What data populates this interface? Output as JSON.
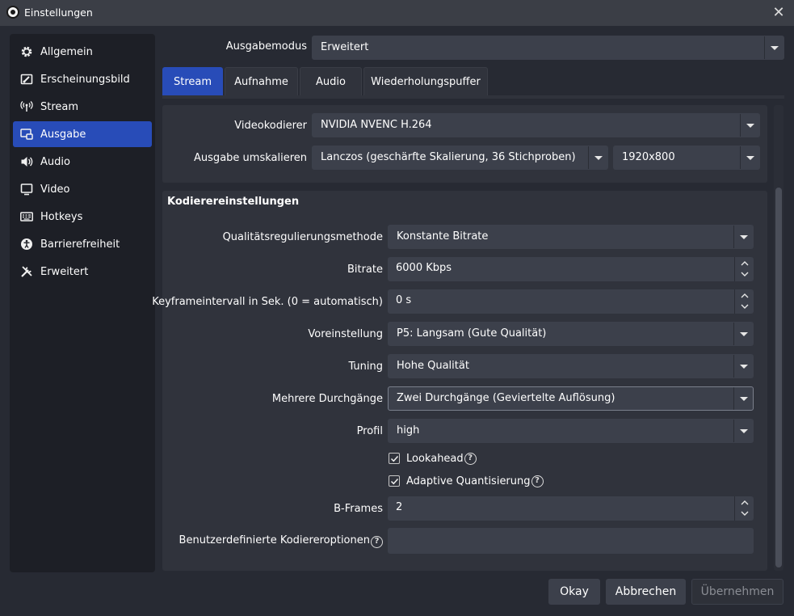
{
  "window": {
    "title": "Einstellungen",
    "close_glyph": "✕"
  },
  "sidebar": {
    "items": [
      {
        "label": "Allgemein",
        "icon": "gear-icon"
      },
      {
        "label": "Erscheinungsbild",
        "icon": "appearance-icon"
      },
      {
        "label": "Stream",
        "icon": "antenna-icon"
      },
      {
        "label": "Ausgabe",
        "icon": "output-icon",
        "active": true
      },
      {
        "label": "Audio",
        "icon": "speaker-icon"
      },
      {
        "label": "Video",
        "icon": "monitor-icon"
      },
      {
        "label": "Hotkeys",
        "icon": "keyboard-icon"
      },
      {
        "label": "Barrierefreiheit",
        "icon": "accessibility-icon"
      },
      {
        "label": "Erweitert",
        "icon": "tools-icon"
      }
    ]
  },
  "output_mode": {
    "label": "Ausgabemodus",
    "value": "Erweitert"
  },
  "tabs": [
    {
      "label": "Stream",
      "active": true
    },
    {
      "label": "Aufnahme"
    },
    {
      "label": "Audio"
    },
    {
      "label": "Wiederholungspuffer"
    }
  ],
  "encoder": {
    "label": "Videokodierer",
    "value": "NVIDIA NVENC H.264"
  },
  "rescale": {
    "label": "Ausgabe umskalieren",
    "filter": "Lanczos (geschärfte Skalierung, 36 Stichproben)",
    "resolution": "1920x800"
  },
  "encoder_settings": {
    "title": "Kodierereinstellungen",
    "rate_control": {
      "label": "Qualitätsregulierungsmethode",
      "value": "Konstante Bitrate"
    },
    "bitrate": {
      "label": "Bitrate",
      "value": "6000 Kbps"
    },
    "keyframe": {
      "label": "Keyframeintervall in Sek. (0 = automatisch)",
      "value": "0 s"
    },
    "preset": {
      "label": "Voreinstellung",
      "value": "P5: Langsam (Gute Qualität)"
    },
    "tuning": {
      "label": "Tuning",
      "value": "Hohe Qualität"
    },
    "multipass": {
      "label": "Mehrere Durchgänge",
      "value": "Zwei Durchgänge (Geviertelte Auflösung)"
    },
    "profile": {
      "label": "Profil",
      "value": "high"
    },
    "lookahead": {
      "label": "Lookahead",
      "checked": true
    },
    "aq": {
      "label": "Adaptive Quantisierung",
      "checked": true
    },
    "bframes": {
      "label": "B-Frames",
      "value": "2"
    },
    "custom": {
      "label": "Benutzerdefinierte Kodiereroptionen",
      "value": ""
    },
    "help_glyph": "?"
  },
  "buttons": {
    "ok": "Okay",
    "cancel": "Abbrechen",
    "apply": "Übernehmen"
  },
  "colors": {
    "accent": "#284cb8",
    "background": "#272a33",
    "panel": "#30333c",
    "input": "#3c404b"
  }
}
